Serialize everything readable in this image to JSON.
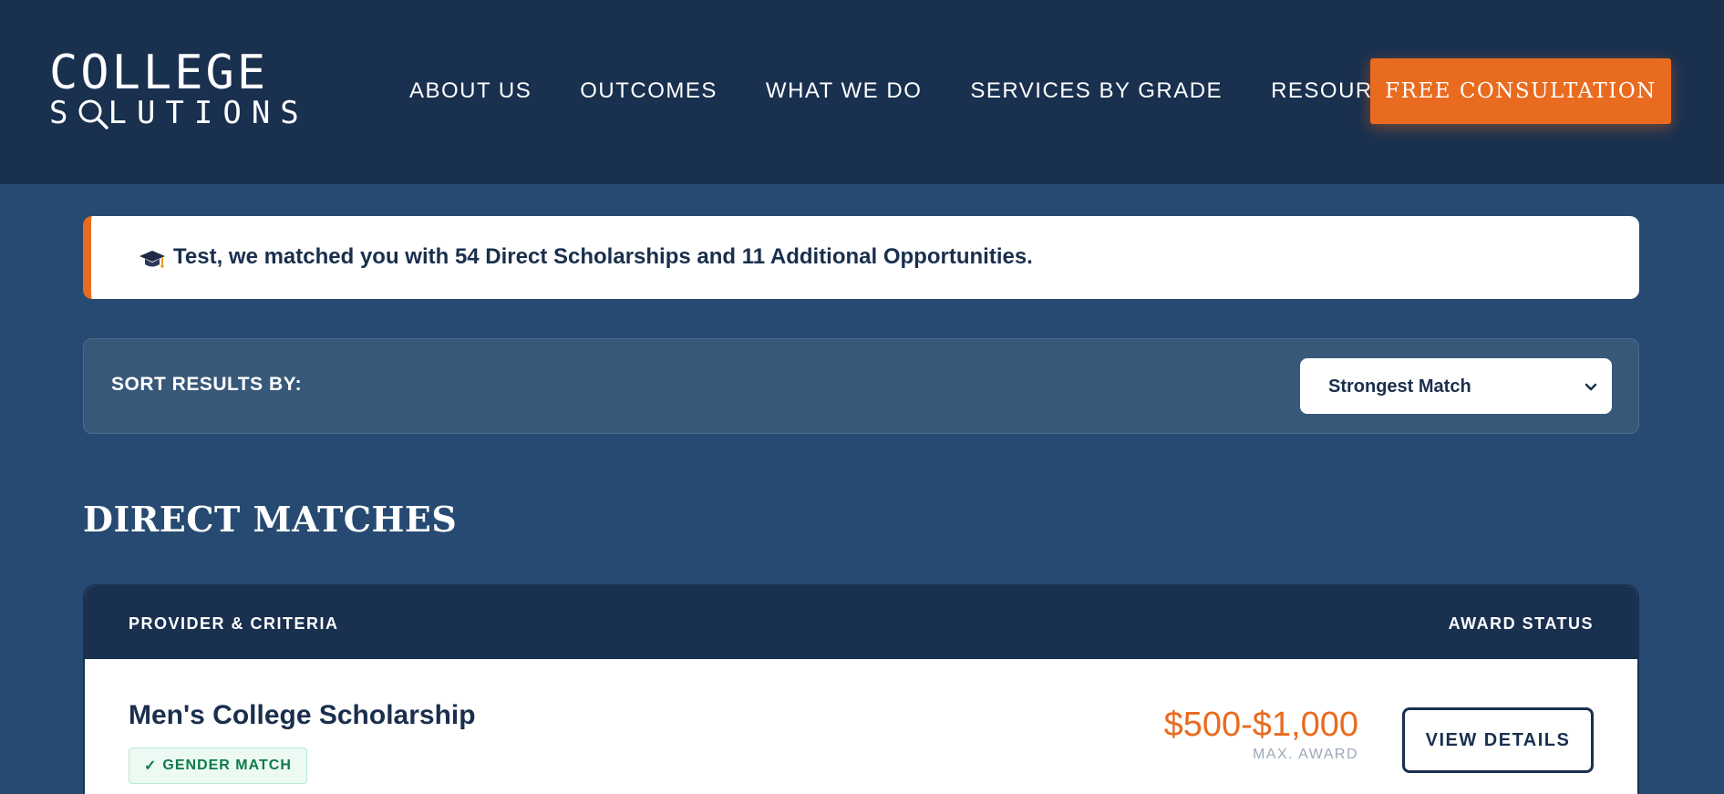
{
  "header": {
    "logo": {
      "line1": "COLLEGE",
      "line2_prefix": "S",
      "line2_suffix": "LUTIONS"
    },
    "nav": [
      {
        "label": "ABOUT US"
      },
      {
        "label": "OUTCOMES"
      },
      {
        "label": "WHAT WE DO"
      },
      {
        "label": "SERVICES BY GRADE"
      },
      {
        "label": "RESOURCES"
      }
    ],
    "cta_label": "FREE CONSULTATION"
  },
  "banner": {
    "icon": "graduation-cap-icon",
    "text": "Test, we matched you with 54 Direct Scholarships and 11 Additional Opportunities."
  },
  "sort": {
    "label": "SORT RESULTS BY:",
    "selected": "Strongest Match"
  },
  "section": {
    "title": "DIRECT MATCHES"
  },
  "table": {
    "headers": {
      "left": "PROVIDER & CRITERIA",
      "right": "AWARD STATUS"
    },
    "rows": [
      {
        "title": "Men's College Scholarship",
        "badge_check": "✓",
        "badge": "GENDER MATCH",
        "amount": "$500-$1,000",
        "amount_label": "MAX. AWARD",
        "button": "VIEW DETAILS"
      }
    ]
  },
  "colors": {
    "header_bg": "#19304f",
    "page_bg": "#264a72",
    "accent": "#e96b1f",
    "text_dark": "#1a2f4d",
    "badge_green": "#0f7a4a"
  }
}
